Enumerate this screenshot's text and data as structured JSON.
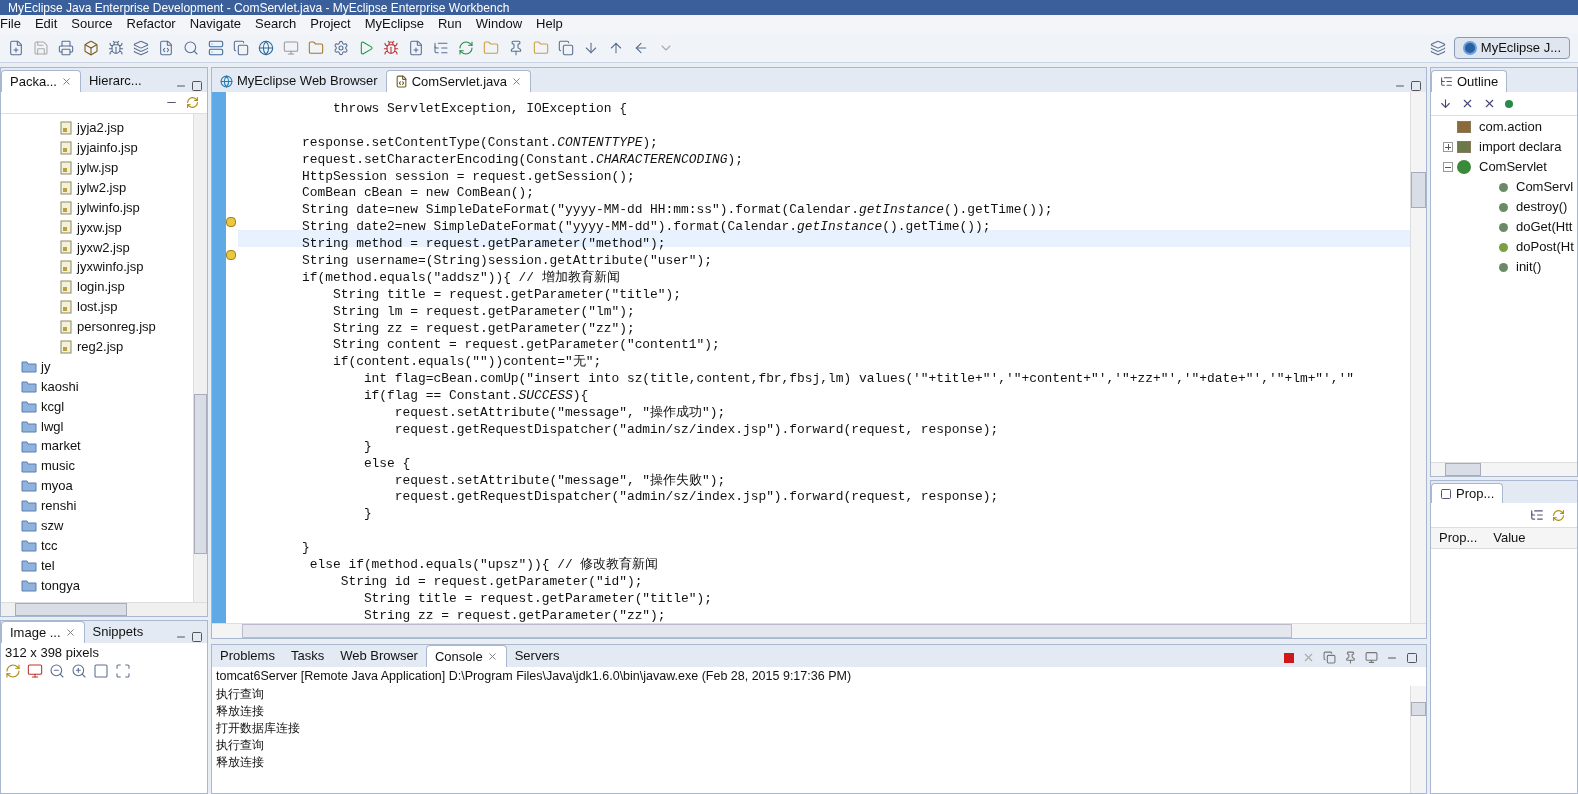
{
  "window": {
    "title": "MyEclipse Java Enterprise Development - ComServlet.java - MyEclipse Enterprise Workbench"
  },
  "menu": [
    "File",
    "Edit",
    "Source",
    "Refactor",
    "Navigate",
    "Search",
    "Project",
    "MyEclipse",
    "Run",
    "Window",
    "Help"
  ],
  "perspective": {
    "label": "MyEclipse J..."
  },
  "left_panel": {
    "tabs": [
      {
        "label": "Packa...",
        "selected": true
      },
      {
        "label": "Hierarc...",
        "selected": false
      }
    ],
    "tree": [
      {
        "children": [
          {
            "label": "jyja2.jsp"
          },
          {
            "label": "jyjainfo.jsp"
          },
          {
            "label": "jylw.jsp"
          },
          {
            "label": "jylw2.jsp"
          },
          {
            "label": "jylwinfo.jsp"
          },
          {
            "label": "jyxw.jsp"
          },
          {
            "label": "jyxw2.jsp"
          },
          {
            "label": "jyxwinfo.jsp"
          },
          {
            "label": "login.jsp"
          },
          {
            "label": "lost.jsp"
          },
          {
            "label": "personreg.jsp"
          },
          {
            "label": "reg2.jsp"
          }
        ]
      },
      {
        "label": "jy"
      },
      {
        "label": "kaoshi"
      },
      {
        "label": "kcgl"
      },
      {
        "label": "lwgl"
      },
      {
        "label": "market"
      },
      {
        "label": "music"
      },
      {
        "label": "myoa"
      },
      {
        "label": "renshi"
      },
      {
        "label": "szw"
      },
      {
        "label": "tcc"
      },
      {
        "label": "tel"
      },
      {
        "label": "tongya"
      }
    ]
  },
  "image_panel": {
    "tabs": [
      {
        "label": "Image ...",
        "selected": true
      },
      {
        "label": "Snippets",
        "selected": false
      }
    ],
    "info": "312 x 398 pixels"
  },
  "editor": {
    "tabs": [
      {
        "label": "MyEclipse Web Browser",
        "selected": false,
        "kind": "browser"
      },
      {
        "label": "ComServlet.java",
        "selected": true,
        "kind": "java"
      }
    ],
    "lines": [
      {
        "kind": "code",
        "text": "    throws ServletException, IOException {",
        "highlighted": false,
        "warning": false
      },
      {
        "kind": "blank",
        "highlighted": false,
        "warning": false
      },
      {
        "kind": "code",
        "text": "response.setContentType(Constant.*CONTENTTYPE*);",
        "highlighted": false,
        "warning": false
      },
      {
        "kind": "code",
        "text": "request.setCharacterEncoding(Constant.*CHARACTERENCODING*);",
        "highlighted": false,
        "warning": false
      },
      {
        "kind": "code",
        "text": "HttpSession session = request.getSession();",
        "highlighted": false,
        "warning": false
      },
      {
        "kind": "code",
        "text": "ComBean cBean = new ComBean();",
        "highlighted": false,
        "warning": false
      },
      {
        "kind": "code",
        "text": "String date=new SimpleDateFormat(\"yyyy-MM-dd HH:mm:ss\").format(Calendar.*getInstance*().getTime());",
        "highlighted": false,
        "warning": false
      },
      {
        "kind": "code",
        "text": "String date2=new SimpleDateFormat(\"yyyy-MM-dd\").format(Calendar.*getInstance*().getTime());",
        "highlighted": false,
        "warning": true
      },
      {
        "kind": "code",
        "text": "String method = request.getParameter(\"method\");",
        "highlighted": true,
        "warning": false
      },
      {
        "kind": "code",
        "text": "String username=(String)session.getAttribute(\"user\");",
        "highlighted": false,
        "warning": true
      },
      {
        "kind": "code",
        "text": "if(method.equals(\"addsz\")){ // 增加教育新闻",
        "highlighted": false,
        "warning": false
      },
      {
        "kind": "code",
        "text": "    String title = request.getParameter(\"title\");",
        "highlighted": false,
        "warning": false
      },
      {
        "kind": "code",
        "text": "    String lm = request.getParameter(\"lm\");",
        "highlighted": false,
        "warning": false
      },
      {
        "kind": "code",
        "text": "    String zz = request.getParameter(\"zz\");",
        "highlighted": false,
        "warning": false
      },
      {
        "kind": "code",
        "text": "    String content = request.getParameter(\"content1\");",
        "highlighted": false,
        "warning": false
      },
      {
        "kind": "code",
        "text": "    if(content.equals(\"\"))content=\"无\";",
        "highlighted": false,
        "warning": false
      },
      {
        "kind": "code",
        "text": "        int flag=cBean.comUp(\"insert into sz(title,content,fbr,fbsj,lm) values('\"+title+\"','\"+content+\"','\"+zz+\"','\"+date+\"','\"+lm+\"','\"",
        "highlighted": false,
        "warning": false
      },
      {
        "kind": "code",
        "text": "        if(flag == Constant.*SUCCESS*){",
        "highlighted": false,
        "warning": false
      },
      {
        "kind": "code",
        "text": "            request.setAttribute(\"message\", \"操作成功\");",
        "highlighted": false,
        "warning": false
      },
      {
        "kind": "code",
        "text": "            request.getRequestDispatcher(\"admin/sz/index.jsp\").forward(request, response);",
        "highlighted": false,
        "warning": false
      },
      {
        "kind": "code",
        "text": "        }",
        "highlighted": false,
        "warning": false
      },
      {
        "kind": "code",
        "text": "        else {",
        "highlighted": false,
        "warning": false
      },
      {
        "kind": "code",
        "text": "            request.setAttribute(\"message\", \"操作失败\");",
        "highlighted": false,
        "warning": false
      },
      {
        "kind": "code",
        "text": "            request.getRequestDispatcher(\"admin/sz/index.jsp\").forward(request, response);",
        "highlighted": false,
        "warning": false
      },
      {
        "kind": "code",
        "text": "        }",
        "highlighted": false,
        "warning": false
      },
      {
        "kind": "blank",
        "highlighted": false,
        "warning": false
      },
      {
        "kind": "code",
        "text": "}",
        "highlighted": false,
        "warning": false
      },
      {
        "kind": "code",
        "text": " else if(method.equals(\"upsz\")){ // 修改教育新闻",
        "highlighted": false,
        "warning": false
      },
      {
        "kind": "code",
        "text": "     String id = request.getParameter(\"id\");",
        "highlighted": false,
        "warning": false
      },
      {
        "kind": "code",
        "text": "        String title = request.getParameter(\"title\");",
        "highlighted": false,
        "warning": false
      },
      {
        "kind": "code",
        "text": "        String zz = request.getParameter(\"zz\");",
        "highlighted": false,
        "warning": false
      }
    ]
  },
  "outline": {
    "tab": "Outline",
    "items": [
      {
        "label": "com.action",
        "kind": "package"
      },
      {
        "label": "import declara",
        "kind": "imports",
        "expanded": false
      },
      {
        "label": "ComServlet",
        "kind": "class",
        "expanded": true,
        "children": [
          {
            "label": "ComServl",
            "kind": "constructor"
          },
          {
            "label": "destroy()",
            "kind": "method"
          },
          {
            "label": "doGet(Htt",
            "kind": "method"
          },
          {
            "label": "doPost(Ht",
            "kind": "override"
          },
          {
            "label": "init()",
            "kind": "method"
          }
        ]
      }
    ]
  },
  "properties": {
    "tab": "Prop...",
    "columns": [
      "Prop...",
      "Value"
    ]
  },
  "console": {
    "tabs": [
      {
        "label": "Problems",
        "selected": false
      },
      {
        "label": "Tasks",
        "selected": false
      },
      {
        "label": "Web Browser",
        "selected": false
      },
      {
        "label": "Console",
        "selected": true
      },
      {
        "label": "Servers",
        "selected": false
      }
    ],
    "header": "tomcat6Server [Remote Java Application] D:\\Program Files\\Java\\jdk1.6.0\\bin\\javaw.exe (Feb 28, 2015 9:17:36 PM)",
    "lines": [
      "执行查询",
      "释放连接",
      "打开数据库连接",
      "执行查询",
      "释放连接"
    ]
  }
}
